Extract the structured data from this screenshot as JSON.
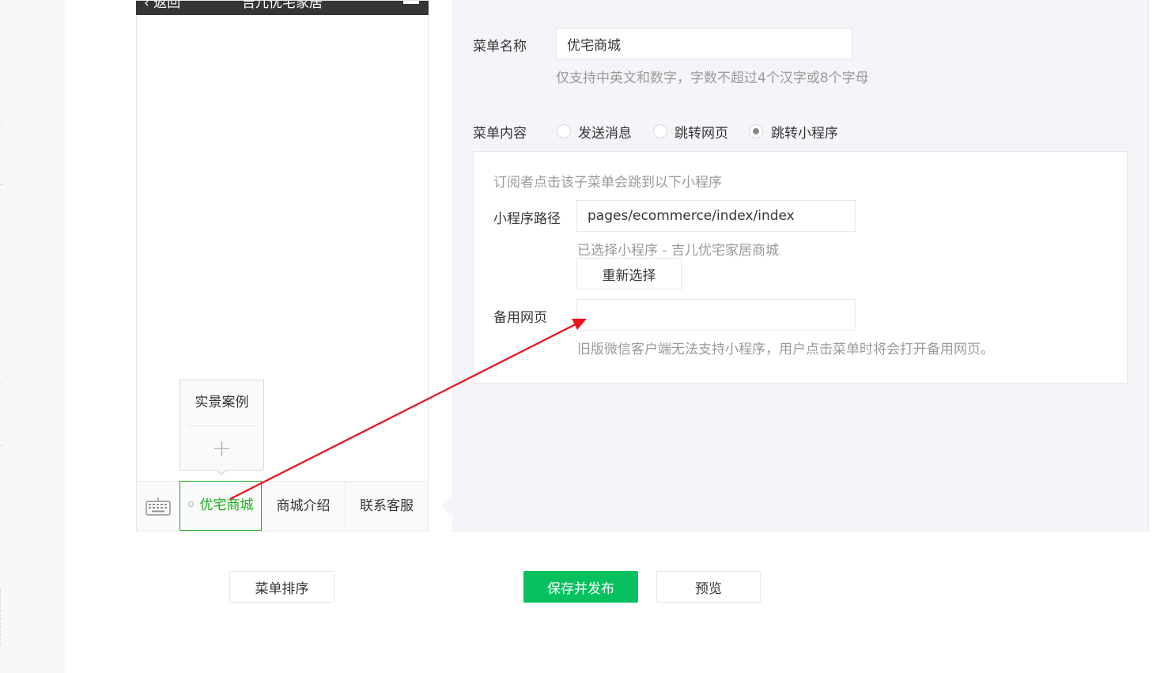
{
  "phone": {
    "back_label": "‹ 返回",
    "title": "吉儿优宅家居"
  },
  "submenu": {
    "items": [
      "实景案例"
    ],
    "add_label": "+"
  },
  "menubar": {
    "tabs": [
      "优宅商城",
      "商城介绍",
      "联系客服"
    ],
    "active_index": 0
  },
  "editor": {
    "name_label": "菜单名称",
    "name_value": "优宅商城",
    "name_tip": "仅支持中英文和数字，字数不超过4个汉字或8个字母",
    "content_label": "菜单内容",
    "content_options": [
      "发送消息",
      "跳转网页",
      "跳转小程序"
    ],
    "content_selected": "跳转小程序",
    "miniprogram": {
      "intro": "订阅者点击该子菜单会跳到以下小程序",
      "path_label": "小程序路径",
      "path_value": "pages/ecommerce/index/index",
      "selected_tip": "已选择小程序 - 吉儿优宅家居商城",
      "reselect_label": "重新选择",
      "backup_label": "备用网页",
      "backup_value": "",
      "backup_tip": "旧版微信客户端无法支持小程序，用户点击菜单时将会打开备用网页。"
    }
  },
  "footer": {
    "sort_label": "菜单排序",
    "save_label": "保存并发布",
    "preview_label": "预览"
  },
  "colors": {
    "accent": "#07c160",
    "active_tab": "#1aad19",
    "annotation": "#e8141a"
  }
}
